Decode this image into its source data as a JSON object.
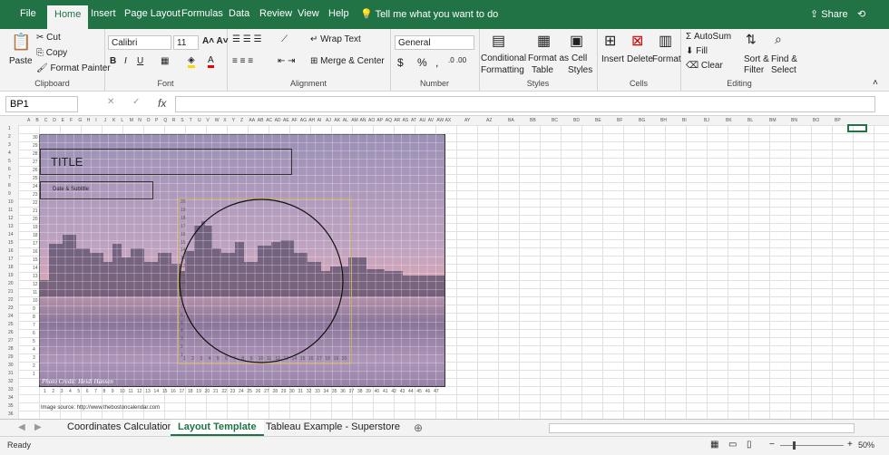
{
  "menu": {
    "items": [
      "File",
      "Home",
      "Insert",
      "Page Layout",
      "Formulas",
      "Data",
      "Review",
      "View",
      "Help"
    ],
    "tell_me": "Tell me what you want to do",
    "share": "Share"
  },
  "ribbon": {
    "clipboard": {
      "paste": "Paste",
      "cut": "Cut",
      "copy": "Copy",
      "format_painter": "Format Painter",
      "label": "Clipboard"
    },
    "font": {
      "font_name": "Calibri",
      "font_size": "11",
      "bold": "B",
      "italic": "I",
      "underline": "U",
      "label": "Font"
    },
    "alignment": {
      "wrap_text": "Wrap Text",
      "merge_center": "Merge & Center",
      "label": "Alignment"
    },
    "number": {
      "format": "General",
      "currency": "$",
      "percent": "%",
      "comma": ",",
      "label": "Number"
    },
    "styles": {
      "conditional": "Conditional",
      "conditional2": "Formatting",
      "format_table": "Format as",
      "format_table2": "Table",
      "cell_styles": "Cell",
      "cell_styles2": "Styles",
      "label": "Styles"
    },
    "cells": {
      "insert": "Insert",
      "delete": "Delete",
      "format": "Format",
      "label": "Cells"
    },
    "editing": {
      "autosum": "AutoSum",
      "fill": "Fill",
      "clear": "Clear",
      "sort": "Sort &",
      "sort2": "Filter",
      "find": "Find &",
      "find2": "Select",
      "label": "Editing"
    }
  },
  "formula_bar": {
    "name_box": "BP1",
    "fx": "fx",
    "value": ""
  },
  "columns": [
    "A",
    "B",
    "C",
    "D",
    "E",
    "F",
    "G",
    "H",
    "I",
    "J",
    "K",
    "L",
    "M",
    "N",
    "O",
    "P",
    "Q",
    "R",
    "S",
    "T",
    "U",
    "V",
    "W",
    "X",
    "Y",
    "Z",
    "AA",
    "AB",
    "AC",
    "AD",
    "AE",
    "AF",
    "AG",
    "AH",
    "AI",
    "AJ",
    "AK",
    "AL",
    "AM",
    "AN",
    "AO",
    "AP",
    "AQ",
    "AR",
    "AS",
    "AT",
    "AU",
    "AV",
    "AW",
    "AX",
    "AY",
    "AZ",
    "BA",
    "BB",
    "BC",
    "BD",
    "BE",
    "BF",
    "BG",
    "BH",
    "BI",
    "BJ",
    "BK",
    "BL",
    "BM",
    "BN",
    "BO",
    "BP"
  ],
  "rows": [
    "1",
    "2",
    "3",
    "4",
    "5",
    "6",
    "7",
    "8",
    "9",
    "10",
    "11",
    "12",
    "13",
    "14",
    "15",
    "16",
    "17",
    "18",
    "19",
    "20",
    "21",
    "22",
    "23",
    "24",
    "25",
    "26",
    "27",
    "28",
    "29",
    "30",
    "31",
    "32",
    "33",
    "34",
    "35",
    "36"
  ],
  "chart": {
    "title": "TITLE",
    "subtitle": "Date & Subtitle",
    "credit": "Photo Credit: Heidi Hansen",
    "source": "Image source: http://www.thebostoncalendar.com",
    "y_axis_outer": [
      "30",
      "29",
      "28",
      "27",
      "26",
      "25",
      "24",
      "23",
      "22",
      "21",
      "20",
      "19",
      "18",
      "17",
      "16",
      "15",
      "14",
      "13",
      "12",
      "11",
      "10",
      "9",
      "8",
      "7",
      "6",
      "5",
      "4",
      "3",
      "2",
      "1"
    ],
    "x_axis_outer": [
      "1",
      "2",
      "3",
      "4",
      "5",
      "6",
      "7",
      "8",
      "9",
      "10",
      "11",
      "12",
      "13",
      "14",
      "15",
      "16",
      "17",
      "18",
      "19",
      "20",
      "21",
      "22",
      "23",
      "24",
      "25",
      "26",
      "27",
      "28",
      "29",
      "30",
      "31",
      "32",
      "33",
      "34",
      "35",
      "36",
      "37",
      "38",
      "39",
      "40",
      "41",
      "42",
      "43",
      "44",
      "45",
      "46",
      "47"
    ],
    "y_axis_inner": [
      "20",
      "19",
      "18",
      "17",
      "16",
      "15",
      "14",
      "13",
      "12",
      "11",
      "10",
      "9",
      "8",
      "7",
      "6",
      "5",
      "4",
      "3",
      "2",
      "1"
    ],
    "x_axis_inner": [
      "1",
      "2",
      "3",
      "4",
      "5",
      "6",
      "7",
      "8",
      "9",
      "10",
      "11",
      "12",
      "13",
      "14",
      "15",
      "16",
      "17",
      "18",
      "19",
      "20"
    ]
  },
  "tabs": [
    "Coordinates Calculation",
    "Layout Template",
    "Tableau Example - Superstore"
  ],
  "status": {
    "ready": "Ready",
    "zoom": "50%"
  }
}
